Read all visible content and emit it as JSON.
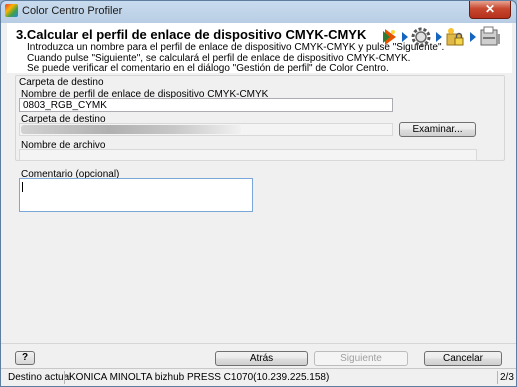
{
  "window": {
    "title": "Color Centro Profiler",
    "close_glyph": "✕"
  },
  "header": {
    "title": "3.Calcular el perfil de enlace de dispositivo CMYK-CMYK",
    "description": [
      "Introduzca un nombre para el perfil de enlace de dispositivo CMYK-CMYK y pulse \"Siguiente\".",
      "Cuando pulse \"Siguiente\", se calculará el perfil de enlace de dispositivo CMYK-CMYK.",
      "Se puede verificar el comentario en el diálogo \"Gestión de perfil\" de Color Centro."
    ],
    "wizard_icons": [
      "play-icon",
      "gear-icon",
      "lock-folder-icon",
      "printer-icon"
    ]
  },
  "destination": {
    "group_label": "Carpeta de destino",
    "profile_name_label": "Nombre de perfil de enlace de dispositivo CMYK-CMYK",
    "profile_name_value": "0803_RGB_CYMK",
    "folder_label": "Carpeta de destino",
    "browse_label": "Examinar...",
    "filename_label": "Nombre de archivo"
  },
  "comment": {
    "label": "Comentario (opcional)",
    "value": ""
  },
  "buttons": {
    "help": "?",
    "back": "Atrás",
    "next": "Siguiente",
    "cancel": "Cancelar"
  },
  "status": {
    "destination_label": "Destino actual",
    "device": "KONICA MINOLTA bizhub PRESS C1070(10.239.225.158)",
    "page": "2/3"
  },
  "colors": {
    "title_bar": "#c9dbee",
    "close": "#c7472f",
    "accent_blue": "#1565c0"
  }
}
